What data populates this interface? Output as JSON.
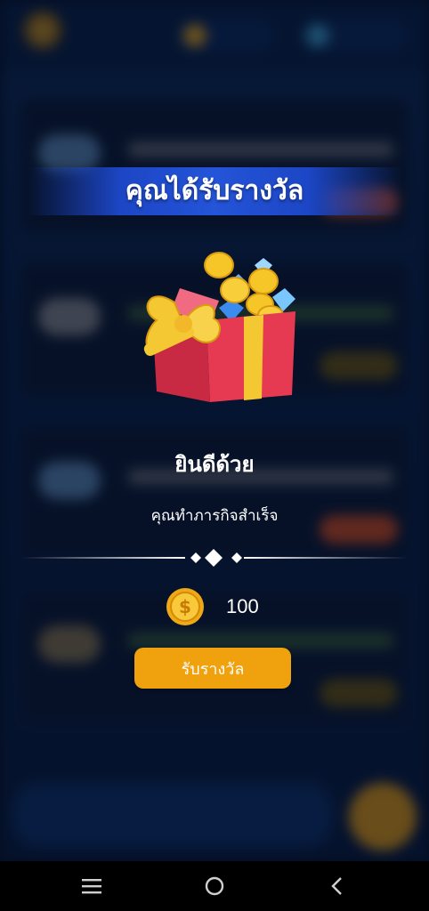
{
  "dialog": {
    "title": "คุณได้รับรางวัล",
    "congrats_text": "ยินดีด้วย",
    "subtitle": "คุณทำภารกิจสำเร็จ",
    "reward_amount": "100",
    "claim_label": "รับรางวัล",
    "gift_icon": "gift-box-with-coins-and-gems",
    "coin_icon": "dollar-coin-icon"
  },
  "colors": {
    "banner": "#2454d8",
    "button": "#efa10e",
    "background": "#0b2552"
  },
  "system_nav": {
    "items": [
      "menu-icon",
      "home-icon",
      "back-icon"
    ]
  }
}
